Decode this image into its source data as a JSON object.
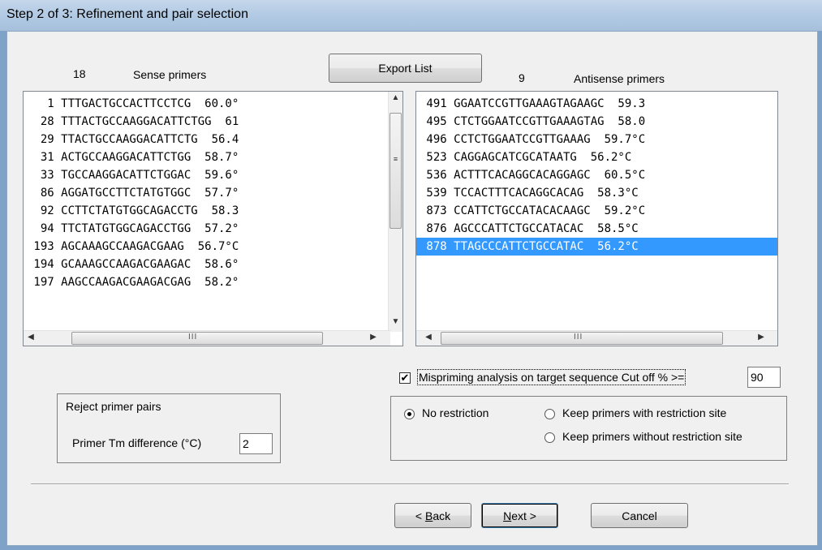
{
  "window": {
    "title": "Step 2 of 3:  Refinement and pair selection"
  },
  "sense": {
    "count": "18",
    "header": "Sense primers",
    "rows": [
      "   1 TTTGACTGCCACTTCCTCG  60.0°",
      "  28 TTTACTGCCAAGGACATTCTGG  61",
      "  29 TTACTGCCAAGGACATTCTG  56.4",
      "  31 ACTGCCAAGGACATTCTGG  58.7°",
      "  33 TGCCAAGGACATTCTGGAC  59.6°",
      "  86 AGGATGCCTTCTATGTGGC  57.7°",
      "  92 CCTTCTATGTGGCAGACCTG  58.3",
      "  94 TTCTATGTGGCAGACCTGG  57.2°",
      " 193 AGCAAAGCCAAGACGAAG  56.7°C",
      " 194 GCAAAGCCAAGACGAAGAC  58.6°",
      " 197 AAGCCAAGACGAAGACGAG  58.2°"
    ]
  },
  "antisense": {
    "count": "9",
    "header": "Antisense primers",
    "selected_index": 8,
    "rows": [
      " 491 GGAATCCGTTGAAAGTAGAAGC  59.3",
      " 495 CTCTGGAATCCGTTGAAAGTAG  58.0",
      " 496 CCTCTGGAATCCGTTGAAAG  59.7°C",
      " 523 CAGGAGCATCGCATAATG  56.2°C",
      " 536 ACTTTCACAGGCACAGGAGC  60.5°C",
      " 539 TCCACTTTCACAGGCACAG  58.3°C",
      " 873 CCATTCTGCCATACACAAGC  59.2°C",
      " 876 AGCCCATTCTGCCATACAC  58.5°C",
      " 878 TTAGCCCATTCTGCCATAC  56.2°C"
    ]
  },
  "export_button": "Export List",
  "mispriming": {
    "checked": true,
    "label": "Mispriming analysis on target sequence   Cut off % >=",
    "cutoff_value": "90"
  },
  "reject": {
    "title": "Reject primer pairs",
    "tm_label": "Primer Tm difference (°C)",
    "tm_value": "2"
  },
  "restriction": {
    "selected": "No restriction",
    "options": [
      "No restriction",
      "Keep primers with restriction site",
      "Keep primers without restriction site"
    ]
  },
  "nav": {
    "back_prefix": "< ",
    "back_key": "B",
    "back_rest": "ack",
    "next_key": "N",
    "next_rest": "ext >",
    "cancel": "Cancel"
  },
  "scrollbar": {
    "grip": "III"
  }
}
